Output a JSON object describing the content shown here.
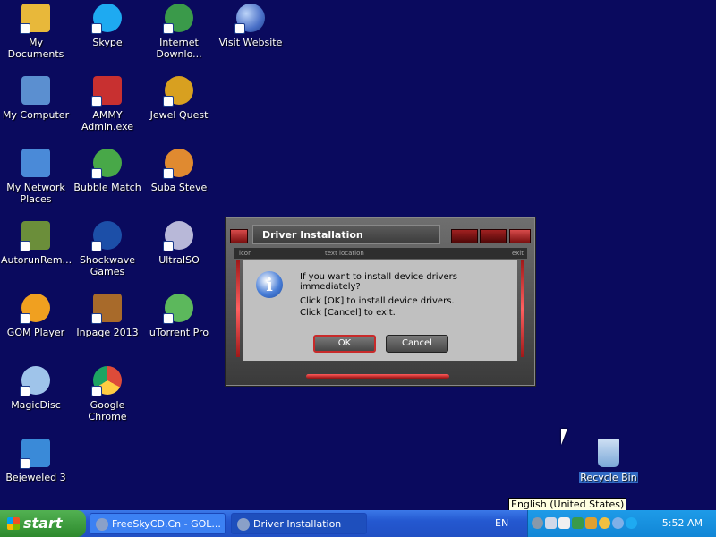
{
  "desktop_icons": [
    {
      "label": "My Documents",
      "icon": "my-documents-icon",
      "color": "#e8b83a"
    },
    {
      "label": "My Computer",
      "icon": "my-computer-icon",
      "color": "#5b8fd0"
    },
    {
      "label": "My Network Places",
      "icon": "network-places-icon",
      "color": "#4a8ad8"
    },
    {
      "label": "AutorunRem...",
      "icon": "autorun-remover-icon",
      "color": "#6b8e3a"
    },
    {
      "label": "GOM Player",
      "icon": "gom-player-icon",
      "color": "#f0a020"
    },
    {
      "label": "MagicDisc",
      "icon": "magicdisc-icon",
      "color": "#9fc4ea"
    },
    {
      "label": "Bejeweled 3",
      "icon": "bejeweled-icon",
      "color": "#3a8ad8"
    },
    {
      "label": "Skype",
      "icon": "skype-icon",
      "color": "#1eaaf1"
    },
    {
      "label": "AMMY Admin.exe",
      "icon": "ammy-admin-icon",
      "color": "#c83030"
    },
    {
      "label": "Bubble Match",
      "icon": "bubble-match-icon",
      "color": "#48a848"
    },
    {
      "label": "Shockwave Games",
      "icon": "shockwave-games-icon",
      "color": "#1c4fa8"
    },
    {
      "label": "Inpage 2013",
      "icon": "inpage-icon",
      "color": "#a86a2a"
    },
    {
      "label": "Google Chrome",
      "icon": "chrome-icon",
      "color": "#dd4b39"
    },
    {
      "label": "Internet Downlo...",
      "icon": "internet-download-manager-icon",
      "color": "#3a9a4a"
    },
    {
      "label": "Jewel Quest",
      "icon": "jewel-quest-icon",
      "color": "#d8a020"
    },
    {
      "label": "Suba Steve",
      "icon": "suba-steve-icon",
      "color": "#e08a30"
    },
    {
      "label": "UltraISO",
      "icon": "ultraiso-icon",
      "color": "#b8b8d8"
    },
    {
      "label": "uTorrent Pro",
      "icon": "utorrent-icon",
      "color": "#5cb85c"
    },
    {
      "label": "Visit Website",
      "icon": "visit-website-icon",
      "color": "#4a70c8"
    },
    {
      "label": "Recycle Bin",
      "icon": "recycle-bin-icon",
      "color": "#7aa8d8"
    }
  ],
  "dialog": {
    "title": "Driver Installation",
    "strip_left": "icon",
    "strip_center": "text location",
    "strip_right": "exit",
    "message_line1": "If you want to install device drivers immediately?",
    "message_line2": "Click [OK] to install device drivers.",
    "message_line3": "Click [Cancel] to exit.",
    "ok_label": "OK",
    "cancel_label": "Cancel"
  },
  "taskbar": {
    "start_label": "start",
    "tasks": [
      {
        "label": "FreeSkyCD.Cn - GOL..."
      },
      {
        "label": "Driver Installation"
      }
    ],
    "language": "EN",
    "clock": "5:52 AM",
    "tooltip": "English (United States)"
  },
  "colors": {
    "desktop_bg": "#0a0a5e",
    "taskbar": "#2458d0",
    "start": "#3a9a3a",
    "dialog_accent": "#c82a2a"
  }
}
